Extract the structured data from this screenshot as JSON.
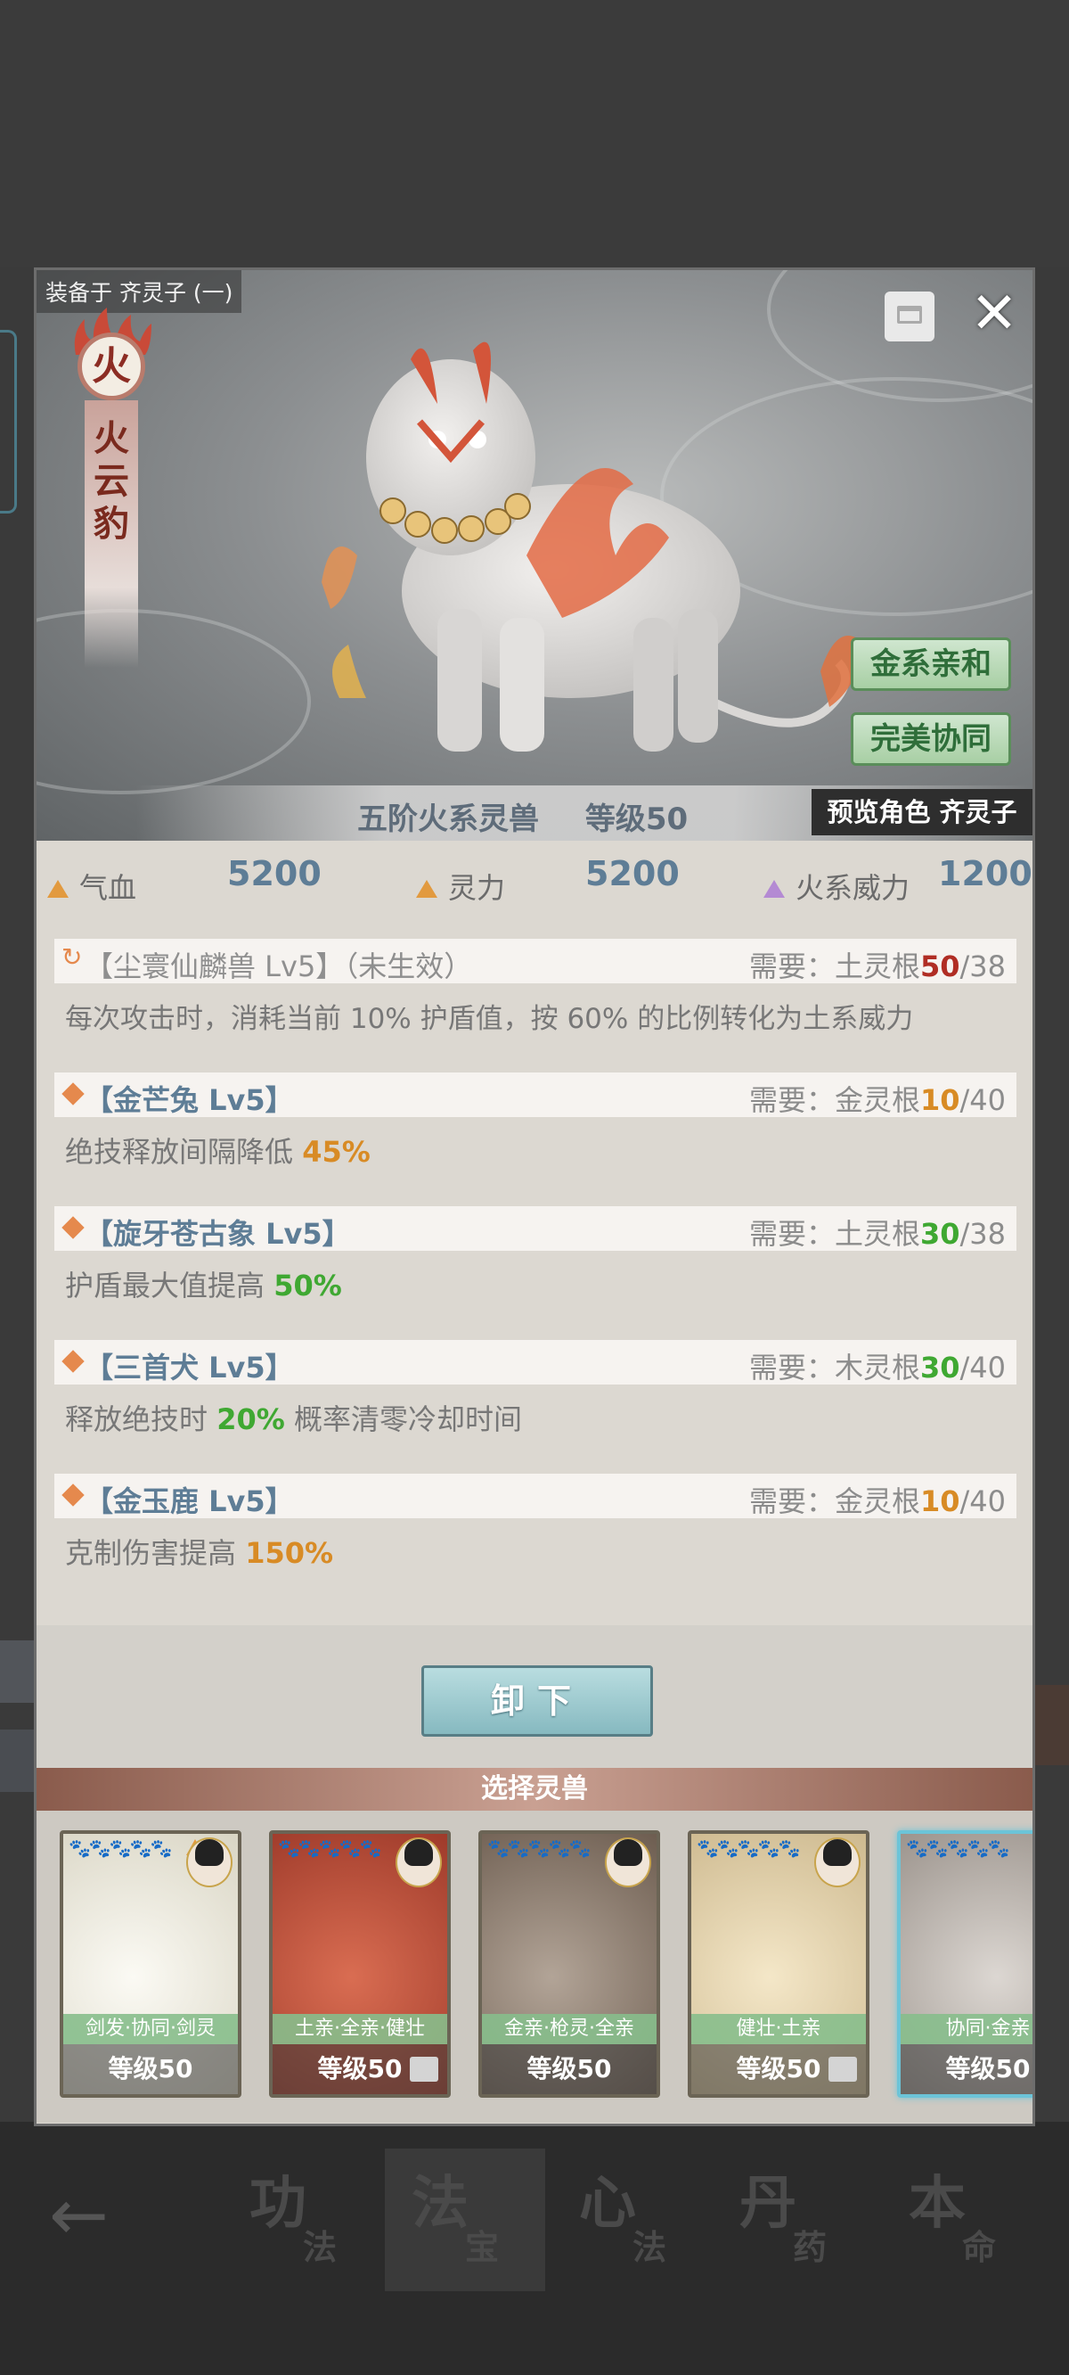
{
  "equipped": {
    "label": "装备于 齐灵子 (一)"
  },
  "element": {
    "glyph": "火",
    "name": "火云豹"
  },
  "tags": [
    "金系亲和",
    "完美协同"
  ],
  "rank": {
    "text": "五阶火系灵兽",
    "level_text": "等级50"
  },
  "preview": "预览角色 齐灵子",
  "stats": [
    {
      "label": "气血",
      "value": "5200",
      "icon": "orange-triangle"
    },
    {
      "label": "灵力",
      "value": "5200",
      "icon": "orange-triangle"
    },
    {
      "label": "火系威力",
      "value": "1200",
      "icon": "purple-triangle"
    }
  ],
  "skills": [
    {
      "name": "【尘寰仙麟兽 Lv5】（未生效）",
      "active": false,
      "req_label": "需要：",
      "req_root": "土灵根",
      "req_cur": "50",
      "req_max": "/38",
      "cur_color": "red",
      "desc_pre": "每次攻击时，消耗当前 10% 护盾值，按 60% 的比例转化为土系威力",
      "desc_val": "",
      "desc_post": "",
      "val_color": ""
    },
    {
      "name": "【金芒兔 Lv5】",
      "active": true,
      "req_label": "需要：",
      "req_root": "金灵根",
      "req_cur": "10",
      "req_max": "/40",
      "cur_color": "orange",
      "desc_pre": "绝技释放间隔降低 ",
      "desc_val": "45%",
      "desc_post": "",
      "val_color": "orange"
    },
    {
      "name": "【旋牙苍古象 Lv5】",
      "active": true,
      "req_label": "需要：",
      "req_root": "土灵根",
      "req_cur": "30",
      "req_max": "/38",
      "cur_color": "green",
      "desc_pre": "护盾最大值提高 ",
      "desc_val": "50%",
      "desc_post": "",
      "val_color": "green"
    },
    {
      "name": "【三首犬 Lv5】",
      "active": true,
      "req_label": "需要：",
      "req_root": "木灵根",
      "req_cur": "30",
      "req_max": "/40",
      "cur_color": "green",
      "desc_pre": "释放绝技时 ",
      "desc_val": "20%",
      "desc_post": " 概率清零冷却时间",
      "val_color": "green"
    },
    {
      "name": "【金玉鹿 Lv5】",
      "active": true,
      "req_label": "需要：",
      "req_root": "金灵根",
      "req_cur": "10",
      "req_max": "/40",
      "cur_color": "orange",
      "desc_pre": "克制伤害提高 ",
      "desc_val": "150%",
      "desc_post": "",
      "val_color": "orange"
    }
  ],
  "unequip_label": "卸下",
  "select_title": "选择灵兽",
  "cards": [
    {
      "tags": "剑发·协同·剑灵",
      "level": "等级50",
      "lock": false,
      "selected": false,
      "tone": "#e8e5d5"
    },
    {
      "tags": "土亲·全亲·健壮",
      "level": "等级50",
      "lock": true,
      "selected": false,
      "tone": "#b7553f"
    },
    {
      "tags": "金亲·枪灵·全亲",
      "level": "等级50",
      "lock": false,
      "selected": false,
      "tone": "#8d7b6b"
    },
    {
      "tags": "健壮·土亲",
      "level": "等级50",
      "lock": true,
      "selected": false,
      "tone": "#e3d7b8"
    },
    {
      "tags": "协同·金亲",
      "level": "等级50",
      "lock": false,
      "selected": true,
      "tone": "#b9b3ab"
    }
  ],
  "paws": "🐾🐾🐾🐾🐾",
  "nav": [
    {
      "big": "功",
      "small": "法"
    },
    {
      "big": "法",
      "small": "宝"
    },
    {
      "big": "心",
      "small": "法"
    },
    {
      "big": "丹",
      "small": "药"
    },
    {
      "big": "本",
      "small": "命"
    }
  ],
  "colors": {
    "accent_blue": "#5e7d96",
    "red": "#b02d24",
    "orange": "#d88b25",
    "green": "#3fa832"
  }
}
